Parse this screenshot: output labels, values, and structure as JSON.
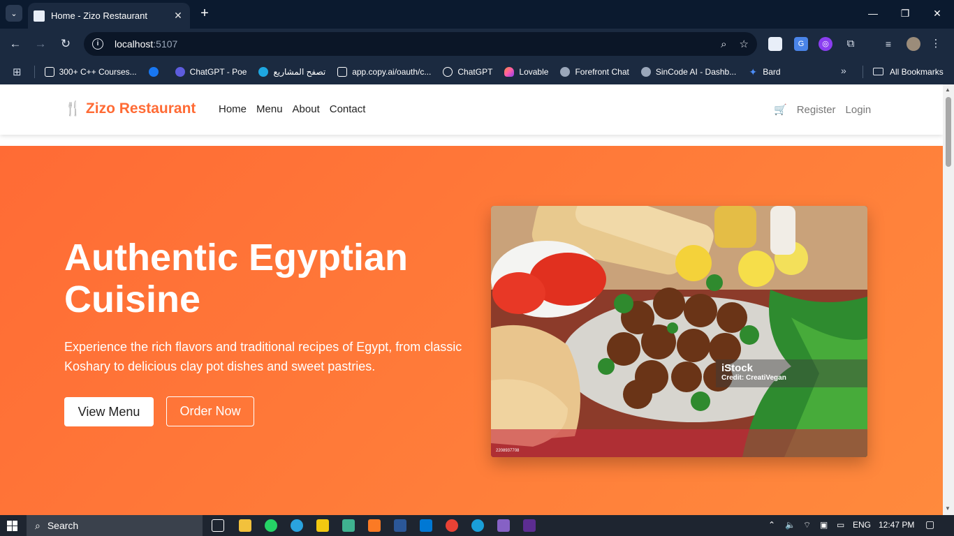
{
  "browser": {
    "tab_title": "Home - Zizo Restaurant",
    "close_glyph": "✕",
    "new_tab_glyph": "+",
    "window_controls": [
      "—",
      "❐",
      "✕"
    ],
    "url_host": "localhost",
    "url_port": ":5107",
    "bookmarks": [
      {
        "label": "300+ C++ Courses...",
        "color": "#ffffff"
      },
      {
        "label": "",
        "color": "#1877f2"
      },
      {
        "label": "ChatGPT - Poe",
        "color": "#5d5cde"
      },
      {
        "label": "تصفح المشاريع",
        "color": "#1ea7e1"
      },
      {
        "label": "app.copy.ai/oauth/c...",
        "color": "#ffffff"
      },
      {
        "label": "ChatGPT",
        "color": "#ffffff"
      },
      {
        "label": "Lovable",
        "color": "#ff5ca8"
      },
      {
        "label": "Forefront Chat",
        "color": "#9aa7ba"
      },
      {
        "label": "SinCode AI - Dashb...",
        "color": "#9aa7ba"
      },
      {
        "label": "Bard",
        "color": "#4c8df6"
      }
    ],
    "all_bookmarks": "All Bookmarks"
  },
  "site": {
    "brand": "Zizo Restaurant",
    "nav": [
      "Home",
      "Menu",
      "About",
      "Contact"
    ],
    "register": "Register",
    "login": "Login",
    "hero_title": "Authentic Egyptian Cuisine",
    "hero_subtitle": "Experience the rich flavors and traditional recipes of Egypt, from classic Koshary to delicious clay pot dishes and sweet pastries.",
    "btn_view_menu": "View Menu",
    "btn_order_now": "Order Now",
    "image": {
      "watermark_brand": "iStock",
      "watermark_credit": "Credit: CreatiVegan",
      "image_id": "2208937708"
    }
  },
  "taskbar": {
    "search": "Search",
    "lang": "ENG",
    "time": "12:47 PM"
  },
  "colors": {
    "accent": "#ff6b35",
    "hero_gradient_end": "#ff8a3d"
  }
}
